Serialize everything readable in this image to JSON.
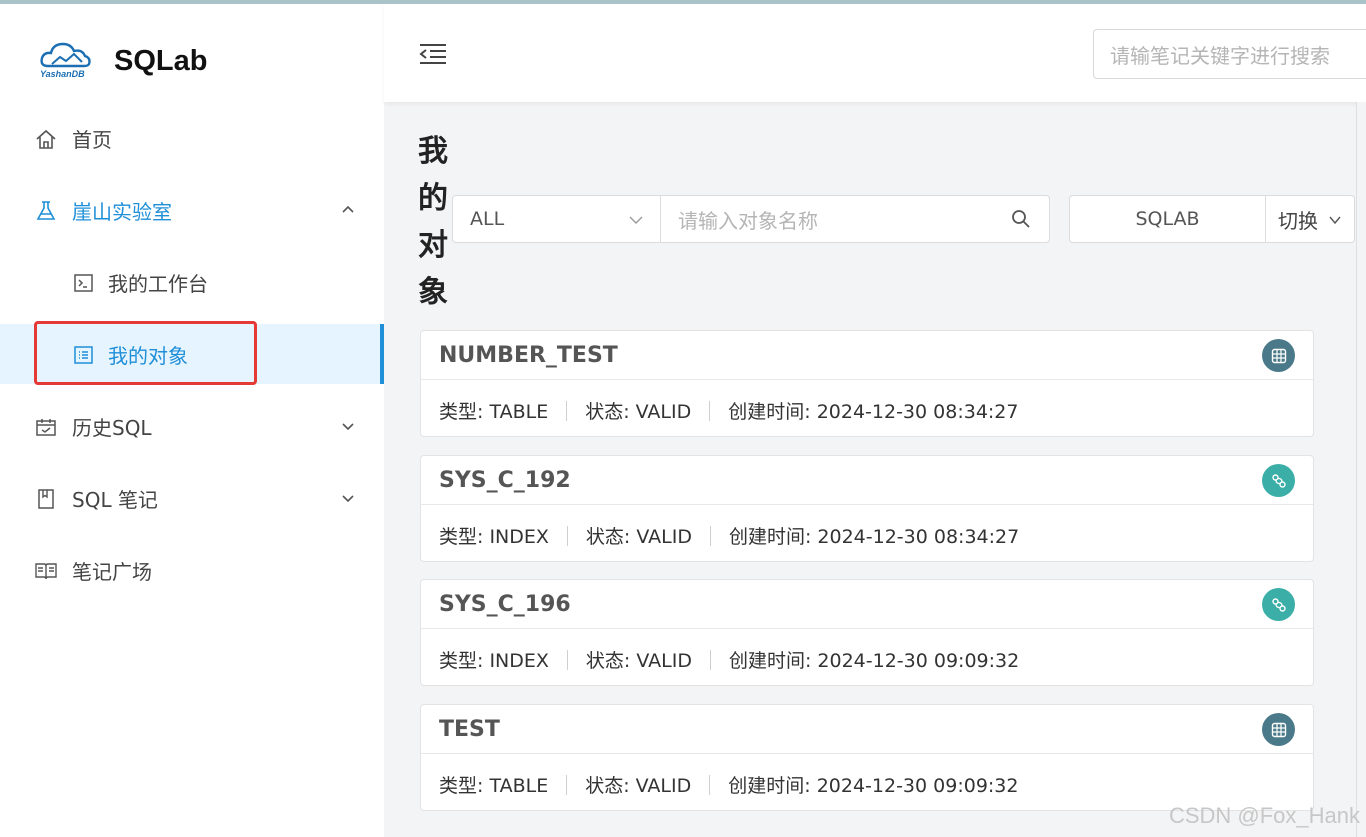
{
  "app": {
    "name": "SQLab",
    "logo_text": "YashanDB"
  },
  "header": {
    "search_placeholder": "请输笔记关键字进行搜索"
  },
  "sidebar": {
    "items": [
      {
        "label": "首页"
      },
      {
        "label": "崖山实验室"
      },
      {
        "label": "我的工作台"
      },
      {
        "label": "我的对象"
      },
      {
        "label": "历史SQL"
      },
      {
        "label": "SQL 笔记"
      },
      {
        "label": "笔记广场"
      }
    ]
  },
  "main": {
    "title": "我的对象",
    "filter": {
      "type_value": "ALL",
      "search_placeholder": "请输入对象名称"
    },
    "db_switch": {
      "db_name": "SQLAB",
      "switch_label": "切换"
    },
    "objects": [
      {
        "name": "NUMBER_TEST",
        "type_label": "类型: TABLE",
        "status_label": "状态: VALID",
        "created_label": "创建时间: 2024-12-30 08:34:27",
        "icon": "table-icon"
      },
      {
        "name": "SYS_C_192",
        "type_label": "类型: INDEX",
        "status_label": "状态: VALID",
        "created_label": "创建时间: 2024-12-30 08:34:27",
        "icon": "index-icon"
      },
      {
        "name": "SYS_C_196",
        "type_label": "类型: INDEX",
        "status_label": "状态: VALID",
        "created_label": "创建时间: 2024-12-30 09:09:32",
        "icon": "index-icon"
      },
      {
        "name": "TEST",
        "type_label": "类型: TABLE",
        "status_label": "状态: VALID",
        "created_label": "创建时间: 2024-12-30 09:09:32",
        "icon": "table-icon"
      }
    ]
  },
  "watermark": "CSDN @Fox_Hank",
  "colors": {
    "accent": "#1f8fd8",
    "active_bg": "#e6f4ff",
    "highlight_box": "#e53935",
    "table_icon": "#4a7a8a",
    "index_icon": "#3aaea7"
  }
}
